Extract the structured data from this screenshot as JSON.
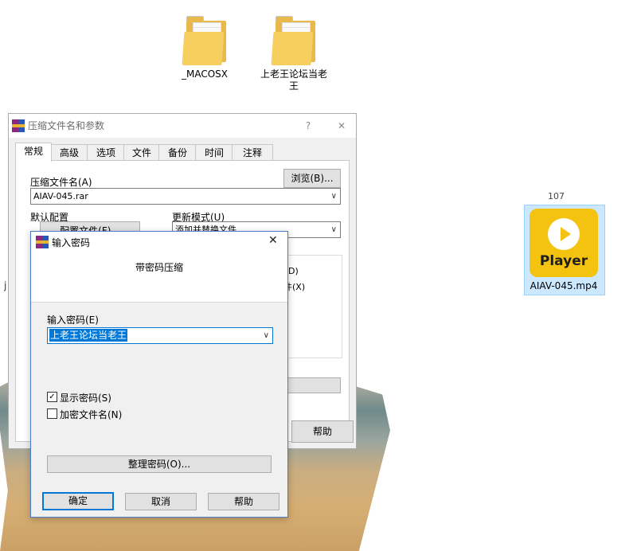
{
  "desktop": {
    "folders": [
      {
        "label": "_MACOSX"
      },
      {
        "label": "上老王论坛当老王"
      }
    ],
    "partial_text": "107",
    "partial_left_char": "j",
    "player_file": {
      "label": "AIAV-045.mp4",
      "icon_text": "Player",
      "icon_color": "#f4c30f"
    }
  },
  "archive_dialog": {
    "title": "压缩文件名和参数",
    "help_icon": "?",
    "close_icon": "✕",
    "tabs": [
      "常规",
      "高级",
      "选项",
      "文件",
      "备份",
      "时间",
      "注释"
    ],
    "archive_name_label": "压缩文件名(A)",
    "browse_label": "浏览(B)...",
    "archive_name_value": "AIAV-045.rar",
    "default_profile_label": "默认配置",
    "profile_button_label": "配置文件(F)...",
    "update_mode_label": "更新模式(U)",
    "update_mode_value": "添加并替换文件",
    "option_fragment_1": "D)",
    "option_fragment_2": "件(X)",
    "help_button_label": "帮助"
  },
  "password_dialog": {
    "title": "输入密码",
    "close_icon": "✕",
    "heading": "带密码压缩",
    "password_label": "输入密码(E)",
    "password_value": "上老王论坛当老王",
    "show_password_label": "显示密码(S)",
    "show_password_checked": true,
    "encrypt_names_label": "加密文件名(N)",
    "encrypt_names_checked": false,
    "organize_button_label": "整理密码(O)...",
    "ok_label": "确定",
    "cancel_label": "取消",
    "help_label": "帮助"
  },
  "colors": {
    "accent": "#0078d7",
    "dialog_bg": "#f0f0f0",
    "folder": "#f6cf5e"
  }
}
